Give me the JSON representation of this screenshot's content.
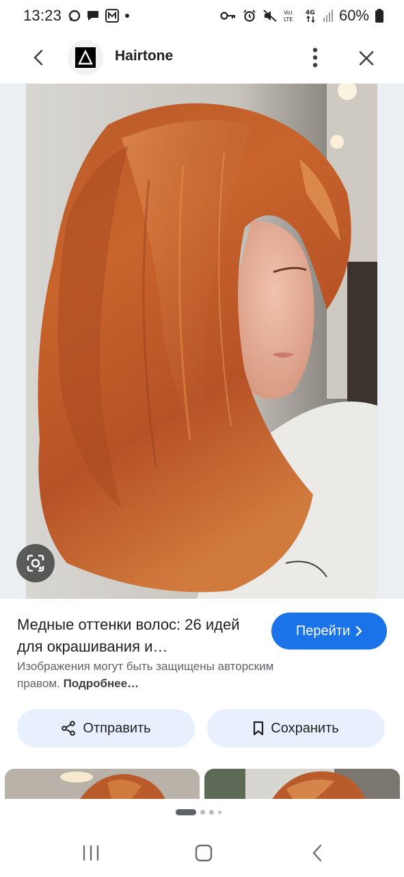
{
  "status_bar": {
    "time": "13:23",
    "battery": "60%",
    "network_type": "4G",
    "volte_label": "Vo) LTE",
    "left_icons": [
      "chat-icon",
      "chat-bubble-icon",
      "m-app-icon",
      "dot-icon"
    ],
    "right_icons": [
      "key-icon",
      "alarm-icon",
      "mute-icon",
      "volte-icon",
      "4g-icon",
      "signal-icon",
      "battery-icon"
    ]
  },
  "header": {
    "site_name": "Hairtone",
    "logo_icon": "delta-logo-icon",
    "back_icon": "back-arrow-icon",
    "more_icon": "more-vert-icon",
    "close_icon": "close-icon"
  },
  "image": {
    "lens_icon": "google-lens-icon"
  },
  "result": {
    "title": "Медные оттенки волос: 26 идей для окрашивания и…",
    "visit_label": "Перейти",
    "copyright_text": "Изображения могут быть защищены авторским правом.",
    "copyright_link": "Подробнее…"
  },
  "actions": {
    "share_label": "Отправить",
    "save_label": "Сохранить"
  },
  "pager": {
    "pages": 4,
    "active_index": 0
  },
  "nav_bar": {
    "recents_icon": "recents-icon",
    "home_icon": "home-icon",
    "back_icon": "nav-back-icon"
  },
  "colors": {
    "accent": "#1a73e8",
    "action_bg": "#e8f0fe",
    "secondary_text": "#5f6368"
  }
}
